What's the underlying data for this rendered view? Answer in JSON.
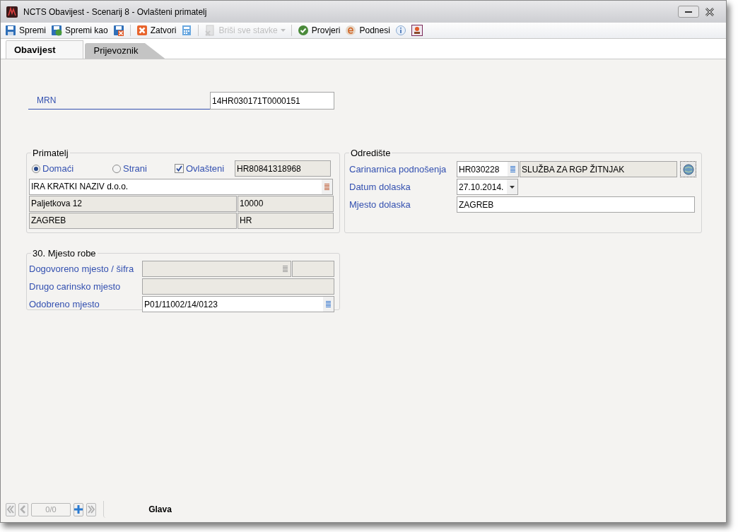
{
  "window": {
    "title": "NCTS Obavijest - Scenarij 8 - Ovlašteni primatelj"
  },
  "toolbar": [
    {
      "kind": "button",
      "label": "Spremi",
      "disabled": false
    },
    {
      "kind": "button",
      "label": "Spremi kao",
      "disabled": false
    },
    {
      "kind": "icon",
      "disabled": false
    },
    {
      "kind": "separator"
    },
    {
      "kind": "button",
      "label": "Zatvori",
      "disabled": false
    },
    {
      "kind": "icon",
      "disabled": false
    },
    {
      "kind": "separator"
    },
    {
      "kind": "dropdown",
      "label": "Briši sve stavke",
      "disabled": true
    },
    {
      "kind": "separator"
    },
    {
      "kind": "button",
      "label": "Provjeri",
      "disabled": false
    },
    {
      "kind": "button",
      "label": "Podnesi",
      "disabled": false
    },
    {
      "kind": "icon",
      "disabled": false
    },
    {
      "kind": "icon",
      "disabled": false
    }
  ],
  "tabs": [
    {
      "label": "Obavijest",
      "selected": true
    },
    {
      "label": "Prijevoznik",
      "selected": false
    }
  ],
  "mrn": {
    "label": "MRN",
    "value": "14HR030171T0000151",
    "disabled": false
  },
  "primatelj": {
    "title": "Primatelj",
    "options": [
      {
        "label": "Domaći",
        "selected": true
      },
      {
        "label": "Strani",
        "selected": false
      }
    ],
    "authorized": {
      "label": "Ovlašteni",
      "checked": true
    },
    "eori": {
      "value": "HR80841318968",
      "disabled": true
    },
    "name": {
      "value": "IRA KRATKI NAZIV d.o.o.",
      "disabled": false
    },
    "street": {
      "value": "Paljetkova 12",
      "disabled": true
    },
    "postcode": {
      "value": "10000",
      "disabled": true
    },
    "city": {
      "value": "ZAGREB",
      "disabled": true
    },
    "country": {
      "value": "HR",
      "disabled": true
    }
  },
  "odrediste": {
    "title": "Odredište",
    "office": {
      "label": "Carinarnica podnošenja",
      "code": {
        "value": "HR030228",
        "disabled": false
      },
      "name": {
        "value": "SLUŽBA ZA RGP ŽITNJAK",
        "disabled": true
      }
    },
    "arrival_date": {
      "label": "Datum dolaska",
      "value": "27.10.2014.",
      "disabled": false
    },
    "arrival_place": {
      "label": "Mjesto dolaska",
      "value": "ZAGREB",
      "disabled": false
    }
  },
  "mjesto_robe": {
    "title": "30. Mjesto robe",
    "agreed": {
      "label": "Dogovoreno mjesto / šifra",
      "place": {
        "disabled": true
      },
      "code": {
        "disabled": true
      }
    },
    "other": {
      "label": "Drugo carinsko mjesto",
      "disabled": true
    },
    "approved": {
      "label": "Odobreno mjesto",
      "value": "P01/11002/14/0123",
      "disabled": false
    }
  },
  "pager": {
    "position": "0/0"
  },
  "bottom_tabs": [
    {
      "label": "Glava",
      "selected": true
    }
  ]
}
